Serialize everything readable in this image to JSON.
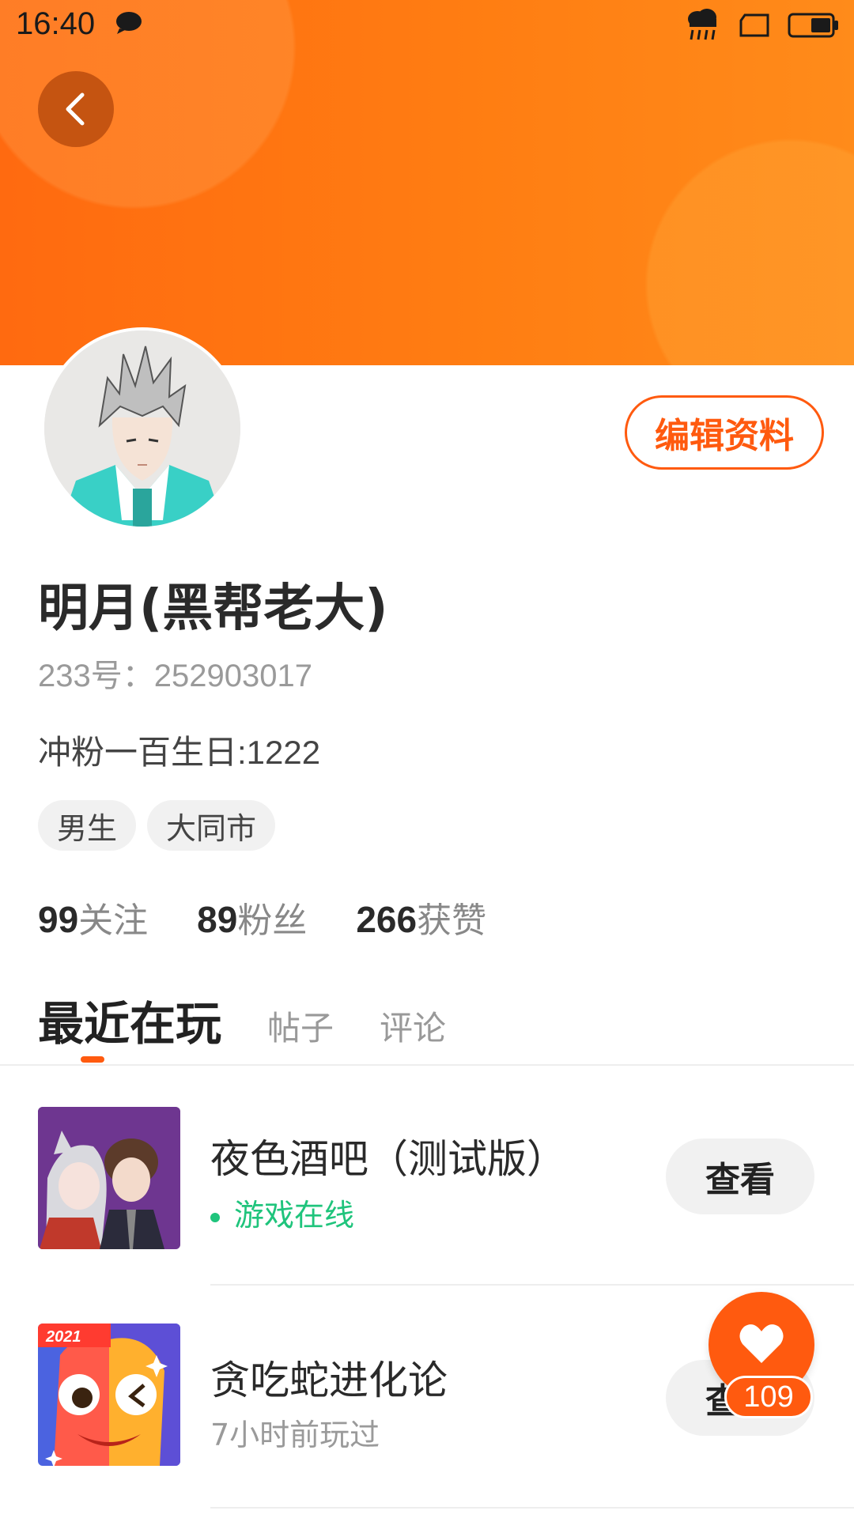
{
  "status_bar": {
    "time": "16:40"
  },
  "profile": {
    "name": "明月(黑帮老大)",
    "uid": "233号：252903017",
    "bio": "冲粉一百生日:1222",
    "tags": [
      "男生",
      "大同市"
    ],
    "edit_label": "编辑资料"
  },
  "stats": [
    {
      "num": "99",
      "label": "关注"
    },
    {
      "num": "89",
      "label": "粉丝"
    },
    {
      "num": "266",
      "label": "获赞"
    }
  ],
  "tabs": [
    {
      "label": "最近在玩",
      "active": true
    },
    {
      "label": "帖子"
    },
    {
      "label": "评论"
    }
  ],
  "games": [
    {
      "title": "夜色酒吧（测试版）",
      "status": "游戏在线",
      "button": "查看"
    },
    {
      "title": "贪吃蛇进化论",
      "status": "7小时前玩过",
      "button": "查看",
      "badge": "2021"
    }
  ],
  "like_fab": {
    "count": "109"
  },
  "colors": {
    "accent": "#ff5a0f",
    "online": "#1fc47c"
  }
}
